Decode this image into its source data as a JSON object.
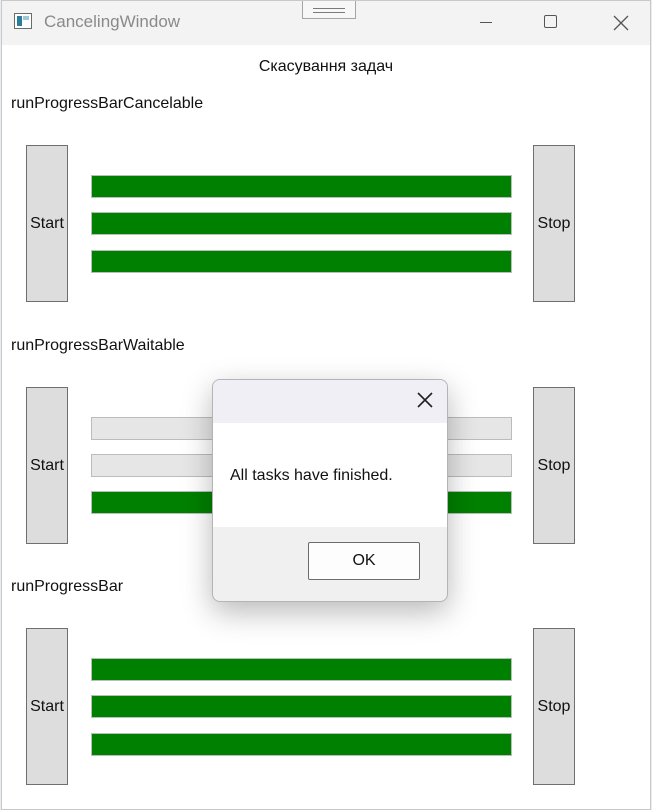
{
  "window": {
    "title": "CancelingWindow",
    "icon": "app-window-icon",
    "controls": [
      "minimize-icon",
      "maximize-icon",
      "close-icon"
    ]
  },
  "heading": "Скасування задач",
  "sections": [
    {
      "label": "runProgressBarCancelable",
      "start_label": "Start",
      "stop_label": "Stop",
      "bars": [
        1,
        1,
        1
      ]
    },
    {
      "label": "runProgressBarWaitable",
      "start_label": "Start",
      "stop_label": "Stop",
      "bars": [
        0,
        0,
        1
      ]
    },
    {
      "label": "runProgressBar",
      "start_label": "Start",
      "stop_label": "Stop",
      "bars": [
        1,
        1,
        1
      ]
    }
  ],
  "dialog": {
    "message": "All tasks have finished.",
    "ok_label": "OK",
    "close_icon": "close-icon"
  },
  "colors": {
    "progress_fill": "#008000",
    "progress_track": "#e6e6e6",
    "button_face": "#dddddd"
  }
}
